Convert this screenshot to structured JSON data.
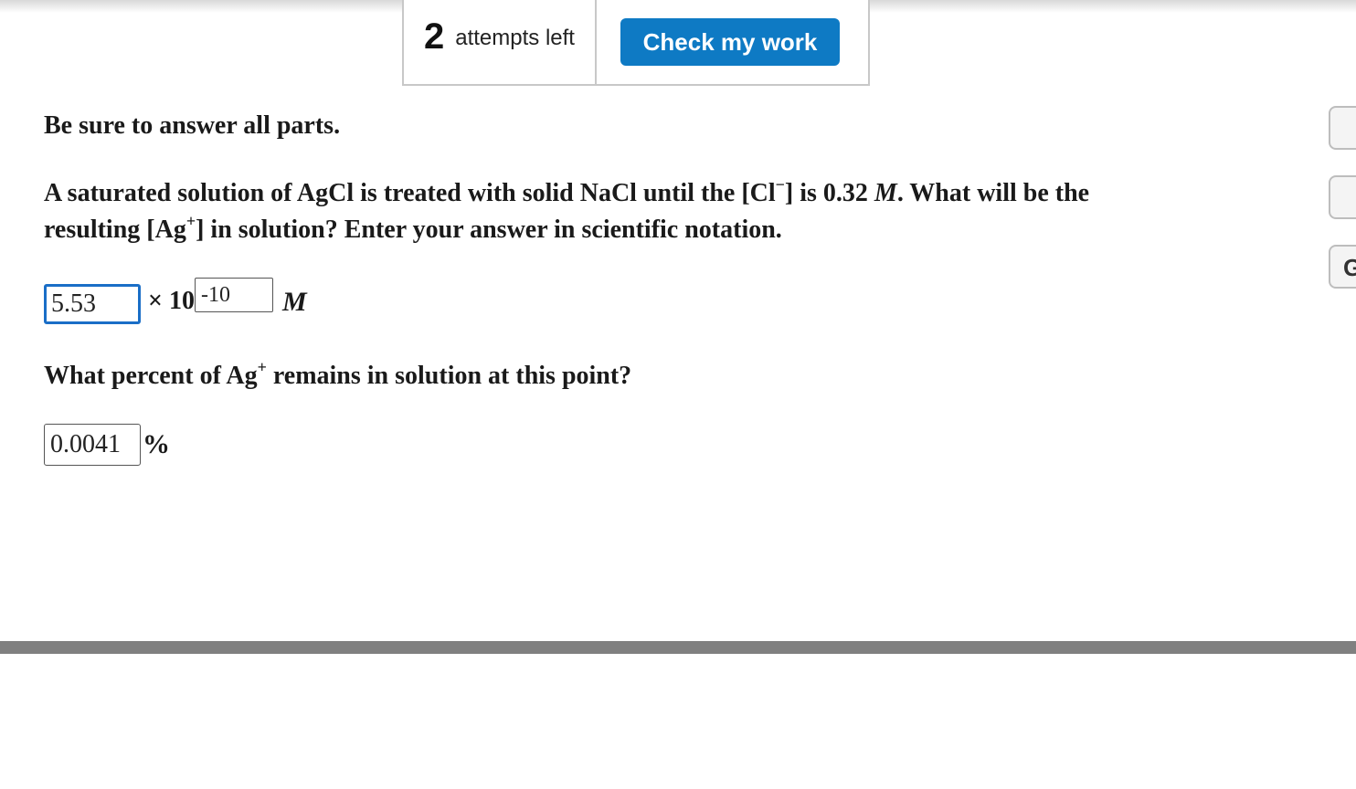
{
  "header": {
    "attempts_count": "2",
    "attempts_label": "attempts left",
    "check_button_label": "Check my work",
    "check_button_color": "#0e7ac4"
  },
  "side_buttons": [
    {
      "label": ""
    },
    {
      "label": ""
    },
    {
      "label": "G"
    }
  ],
  "intro": "Be sure to answer all parts.",
  "question1": {
    "part_a": "A saturated solution of AgCl is treated with solid NaCl until the [Cl",
    "sup_a": "−",
    "part_b": "] is 0.32 ",
    "unit": "M",
    "part_c": ". What will be the resulting [Ag",
    "sup_b": "+",
    "part_d": "] in solution? Enter your answer in scientific notation."
  },
  "answer1": {
    "mantissa_value": "5.53",
    "times_ten": "× 10",
    "exponent_value": "-10",
    "unit": "M"
  },
  "question2": {
    "part_a": "What percent of Ag",
    "sup": "+",
    "part_b": " remains in solution at this point?"
  },
  "answer2": {
    "percent_value": "0.0041",
    "percent_sign": "%"
  }
}
